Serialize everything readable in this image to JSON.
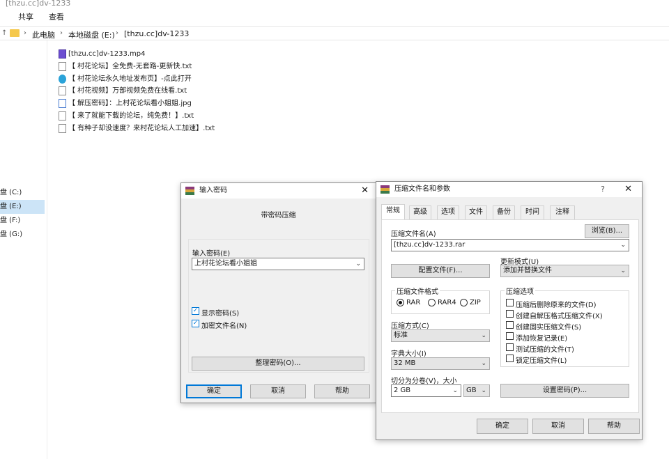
{
  "explorer": {
    "title": "[thzu.cc]dv-1233",
    "ribbon": [
      "共享",
      "查看"
    ],
    "breadcrumb": [
      "此电脑",
      "本地磁盘 (E:)",
      "[thzu.cc]dv-1233"
    ],
    "drives": [
      {
        "label": "盘 (C:)",
        "selected": false
      },
      {
        "label": "盘 (E:)",
        "selected": true
      },
      {
        "label": "盘 (F:)",
        "selected": false
      },
      {
        "label": "盘 (G:)",
        "selected": false
      }
    ],
    "files": [
      {
        "name": "[thzu.cc]dv-1233.mp4",
        "icon": "video-file-icon"
      },
      {
        "name": "【 村花论坛】全免费-无套路-更新快.txt",
        "icon": "text-file-icon"
      },
      {
        "name": "【 村花论坛永久地址发布页】-点此打开",
        "icon": "edge-link-icon"
      },
      {
        "name": "【 村花视频】万部视频免费在线看.txt",
        "icon": "text-file-icon"
      },
      {
        "name": "【 解压密码】：上村花论坛看小姐姐.jpg",
        "icon": "image-file-icon"
      },
      {
        "name": "【 来了就能下载的论坛，纯免费！】.txt",
        "icon": "text-file-icon"
      },
      {
        "name": "【 有种子却没速度？来村花论坛人工加速】.txt",
        "icon": "text-file-icon"
      }
    ]
  },
  "password_dialog": {
    "title": "输入密码",
    "heading": "带密码压缩",
    "password_label": "输入密码(E)",
    "password_value": "上村花论坛看小姐姐",
    "show_password": {
      "label": "显示密码(S)",
      "checked": true
    },
    "encrypt_names": {
      "label": "加密文件名(N)",
      "checked": true
    },
    "organize_button": "整理密码(O)...",
    "ok_button": "确定",
    "cancel_button": "取消",
    "help_button": "帮助"
  },
  "archive_dialog": {
    "title": "压缩文件名和参数",
    "help_glyph": "?",
    "tabs": [
      "常规",
      "高级",
      "选项",
      "文件",
      "备份",
      "时间",
      "注释"
    ],
    "archive_name_label": "压缩文件名(A)",
    "browse_button": "浏览(B)...",
    "archive_name": "[thzu.cc]dv-1233.rar",
    "profiles_button": "配置文件(F)...",
    "update_mode_label": "更新模式(U)",
    "update_mode": "添加并替换文件",
    "format_label": "压缩文件格式",
    "formats": [
      {
        "label": "RAR",
        "selected": true
      },
      {
        "label": "RAR4",
        "selected": false
      },
      {
        "label": "ZIP",
        "selected": false
      }
    ],
    "method_label": "压缩方式(C)",
    "method": "标准",
    "dict_label": "字典大小(I)",
    "dict": "32 MB",
    "split_label": "切分为分卷(V)，大小",
    "split_value": "2 GB",
    "split_unit": "GB",
    "options_label": "压缩选项",
    "options": [
      "压缩后删除原来的文件(D)",
      "创建自解压格式压缩文件(X)",
      "创建固实压缩文件(S)",
      "添加恢复记录(E)",
      "测试压缩的文件(T)",
      "锁定压缩文件(L)"
    ],
    "set_password_button": "设置密码(P)...",
    "ok_button": "确定",
    "cancel_button": "取消",
    "help_button": "帮助"
  }
}
